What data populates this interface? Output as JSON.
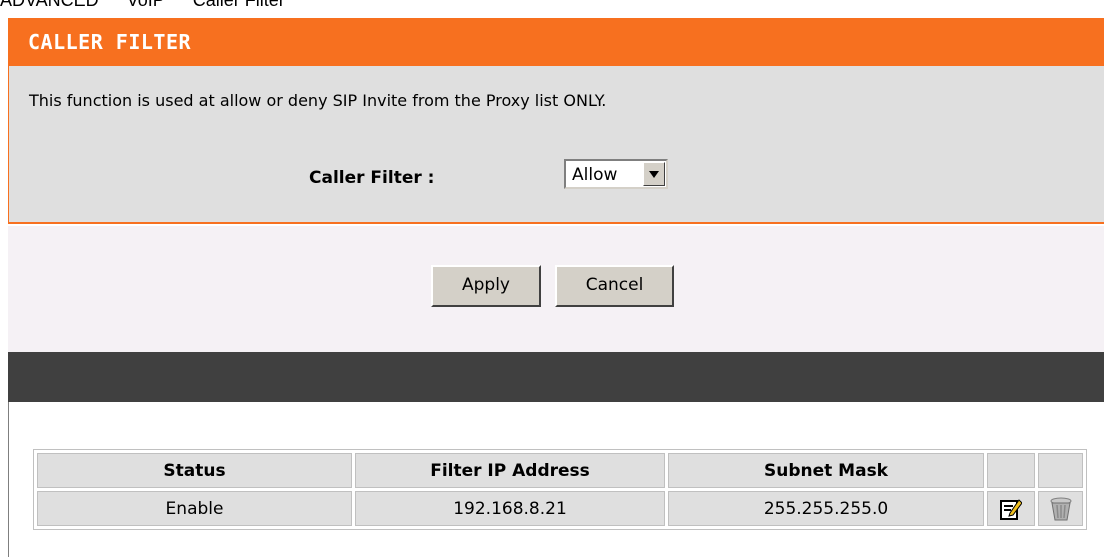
{
  "breadcrumb": {
    "section": "ADVANCED",
    "subsection": "VoIP",
    "page": "Caller Filter"
  },
  "header": {
    "title": "CALLER FILTER"
  },
  "panel": {
    "description": "This function is used at allow or deny SIP Invite from the Proxy list ONLY.",
    "caller_filter_label": "Caller Filter :",
    "caller_filter_value": "Allow"
  },
  "buttons": {
    "apply": "Apply",
    "cancel": "Cancel"
  },
  "table": {
    "headers": [
      "Status",
      "Filter IP Address",
      "Subnet Mask",
      "",
      ""
    ],
    "rows": [
      {
        "status": "Enable",
        "ip": "192.168.8.21",
        "mask": "255.255.255.0",
        "edit_icon": "edit-icon",
        "delete_icon": "trash-icon"
      }
    ]
  },
  "colors": {
    "accent": "#f7701f",
    "panel": "#dfdfdf",
    "dark_bar": "#404040"
  }
}
